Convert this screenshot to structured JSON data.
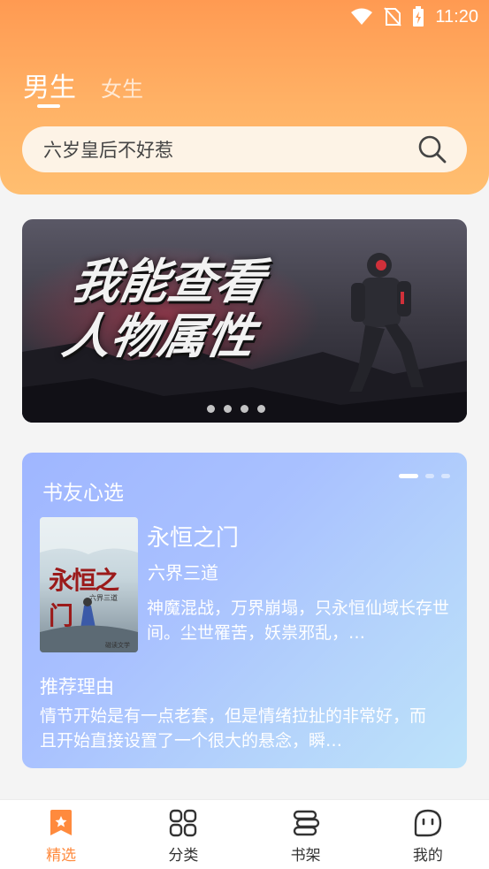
{
  "status_bar": {
    "time": "11:20"
  },
  "tabs": [
    {
      "label": "男生",
      "active": true
    },
    {
      "label": "女生",
      "active": false
    }
  ],
  "search": {
    "text": "六岁皇后不好惹"
  },
  "banner": {
    "title_line1": "我能查看",
    "title_line2": "人物属性",
    "dot_count": 4
  },
  "recommend": {
    "heading": "书友心选",
    "book": {
      "title": "永恒之门",
      "author": "六界三道",
      "description": "神魔混战，万界崩塌，只永恒仙域长存世间。尘世罹苦，妖祟邪乱，…",
      "cover_title": "永恒之门",
      "cover_author": "六界三道",
      "cover_publisher": "磁读文学"
    },
    "reason_label": "推荐理由",
    "reason_text": "情节开始是有一点老套，但是情绪拉扯的非常好，而且开始直接设置了一个很大的悬念，瞬…"
  },
  "bottom_nav": [
    {
      "label": "精选",
      "icon": "bookmark-star-icon",
      "active": true
    },
    {
      "label": "分类",
      "icon": "grid-icon",
      "active": false
    },
    {
      "label": "书架",
      "icon": "bookshelf-icon",
      "active": false
    },
    {
      "label": "我的",
      "icon": "face-icon",
      "active": false
    }
  ],
  "colors": {
    "accent": "#ff8a3d",
    "header": "#ffa95c",
    "card": "#a9c1ff"
  }
}
